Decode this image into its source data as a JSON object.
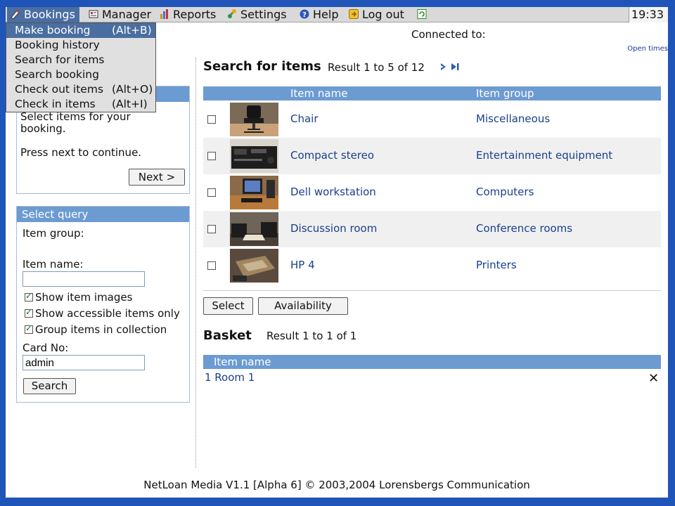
{
  "menubar": {
    "items": [
      {
        "label": "Bookings",
        "icon": "bookings-icon"
      },
      {
        "label": "Manager",
        "icon": "manager-icon"
      },
      {
        "label": "Reports",
        "icon": "reports-icon"
      },
      {
        "label": "Settings",
        "icon": "settings-icon"
      },
      {
        "label": "Help",
        "icon": "help-icon"
      },
      {
        "label": "Log out",
        "icon": "logout-icon"
      }
    ],
    "clock": "19:33"
  },
  "bookings_menu": [
    {
      "label": "Make booking",
      "shortcut": "(Alt+B)"
    },
    {
      "label": "Booking history",
      "shortcut": ""
    },
    {
      "label": "Search for items",
      "shortcut": ""
    },
    {
      "label": "Search booking",
      "shortcut": ""
    },
    {
      "label": "Check out items",
      "shortcut": "(Alt+O)"
    },
    {
      "label": "Check in items",
      "shortcut": "(Alt+I)"
    }
  ],
  "header": {
    "connected": "Connected to:",
    "open_times": "Open times"
  },
  "instructions": {
    "line1": "Select items for your",
    "line2": "booking.",
    "line3": "Press next to continue.",
    "next_label": "Next >"
  },
  "query": {
    "title": "Select query",
    "item_group_label": "Item group:",
    "item_name_label": "Item name:",
    "item_name_value": "",
    "checkboxes": [
      {
        "label": "Show item images",
        "checked": true
      },
      {
        "label": "Show accessible items only",
        "checked": true
      },
      {
        "label": "Group items in collection",
        "checked": true
      }
    ],
    "card_label": "Card No:",
    "card_value": "admin",
    "search_label": "Search"
  },
  "results": {
    "title": "Search for items",
    "count": "Result 1 to 5 of 12",
    "col_name": "Item name",
    "col_group": "Item group",
    "rows": [
      {
        "name": "Chair",
        "group": "Miscellaneous",
        "image": "chair-photo"
      },
      {
        "name": "Compact stereo",
        "group": "Entertainment equipment",
        "image": "stereo-photo"
      },
      {
        "name": "Dell workstation",
        "group": "Computers",
        "image": "workstation-photo"
      },
      {
        "name": "Discussion room",
        "group": "Conference rooms",
        "image": "room-photo"
      },
      {
        "name": "HP 4",
        "group": "Printers",
        "image": "printer-photo"
      }
    ],
    "select_label": "Select",
    "availability_label": "Availability"
  },
  "basket": {
    "title": "Basket",
    "count": "Result 1 to 1 of 1",
    "col_name": "Item name",
    "items": [
      {
        "label": "1 Room 1"
      }
    ]
  },
  "footer": "NetLoan Media V1.1 [Alpha 6] © 2003,2004 Lorensbergs Communication"
}
